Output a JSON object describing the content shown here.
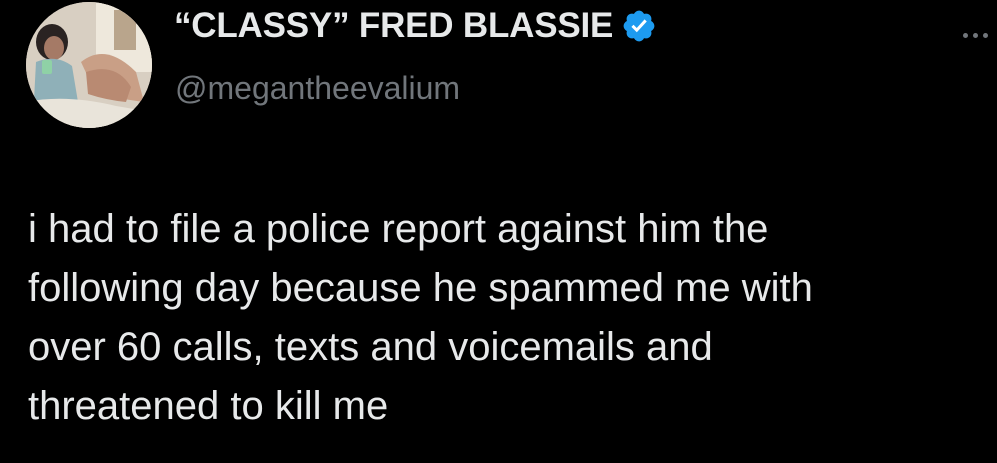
{
  "tweet": {
    "author": {
      "display_name": "“CLASSY” FRED BLASSIE",
      "handle": "@megantheevalium",
      "verified": true,
      "verified_icon": "verified-badge-icon",
      "avatar_icon": "profile-avatar"
    },
    "more_icon": "more-options-icon",
    "text_lines": [
      "i had to file a police report against him the",
      "following day because he spammed me with",
      "over 60 calls, texts and voicemails and",
      "threatened to kill me"
    ]
  },
  "colors": {
    "background": "#000000",
    "text_primary": "#e7e9ea",
    "text_secondary": "#71767b",
    "verified_blue": "#1d9bf0"
  }
}
